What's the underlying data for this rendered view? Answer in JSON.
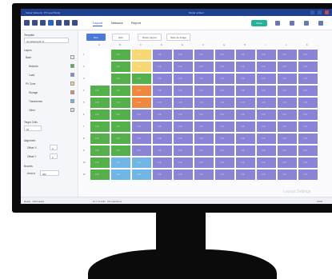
{
  "window": {
    "app_title": "Solver Network - PV Load Study",
    "doc_title": "Model untitled"
  },
  "toolbar": {
    "tabs": [
      "Layout",
      "Network",
      "Report"
    ],
    "active_tab": 0,
    "calculate_label": "Solve",
    "icons": [
      "new-icon",
      "open-icon",
      "save-icon",
      "play-icon",
      "export-icon",
      "print-icon",
      "settings-icon"
    ]
  },
  "panel": {
    "template_label": "Template",
    "template_value": "ref-default-grid-v2",
    "layers_label": "Layers",
    "layers": [
      {
        "label": "Base",
        "color": "#e9ecf3"
      },
      {
        "label": "Network",
        "color": "#54b04a"
      },
      {
        "label": "Load",
        "color": "#8b84d6"
      },
      {
        "label": "PV Zone",
        "color": "#f7d872"
      },
      {
        "label": "Storage",
        "color": "#f0873f"
      },
      {
        "label": "Transformer",
        "color": "#6fb6e6"
      },
      {
        "label": "Other",
        "color": "#d9dbe2"
      }
    ],
    "range_label": "Target Cells",
    "range_value": "64",
    "align_label": "Alignment",
    "offset_x_label": "Offset X",
    "offset_x_value": "0",
    "offset_y_label": "Offset Y",
    "offset_y_value": "0",
    "bounds_label": "Bounds",
    "bounds_value": "Area to",
    "bounds_field": "300"
  },
  "actions": {
    "primary": "Run",
    "second": "Edit",
    "third": "Reset Layout",
    "fourth": "Save as Image"
  },
  "grid": {
    "columns": [
      "A",
      "B",
      "C",
      "D",
      "E",
      "F",
      "G",
      "H",
      "I",
      "J",
      "K"
    ],
    "rows": [
      "1",
      "2",
      "3",
      "4",
      "5",
      "6",
      "7",
      "8",
      "9",
      "10",
      "11"
    ],
    "colors": {
      "W": "#ffffff",
      "G": "#54b04a",
      "Y": "#f7d872",
      "O": "#f0873f",
      "B": "#6fb6e6",
      "P": "#8b84d6"
    },
    "layout": [
      "WGYPPPPPPPP",
      "WGYPPPPPPPP",
      "WGGPPPPPPPP",
      "GGOPPPPPPPP",
      "GGOPPPPPPPP",
      "GGPPPPPPPPP",
      "GGPPPPPPPPP",
      "GGPPPPPPPPP",
      "GGPPPPPPPPP",
      "GBBPPPPPPPP",
      "GBBPPPPPPPP"
    ],
    "cell_text": "0.00",
    "ghost_text": "Layout Settings"
  },
  "status": {
    "left": "Ready  ·  Grid loaded",
    "middle": "11 × 11 cells · 121 total items",
    "right": "100%"
  }
}
